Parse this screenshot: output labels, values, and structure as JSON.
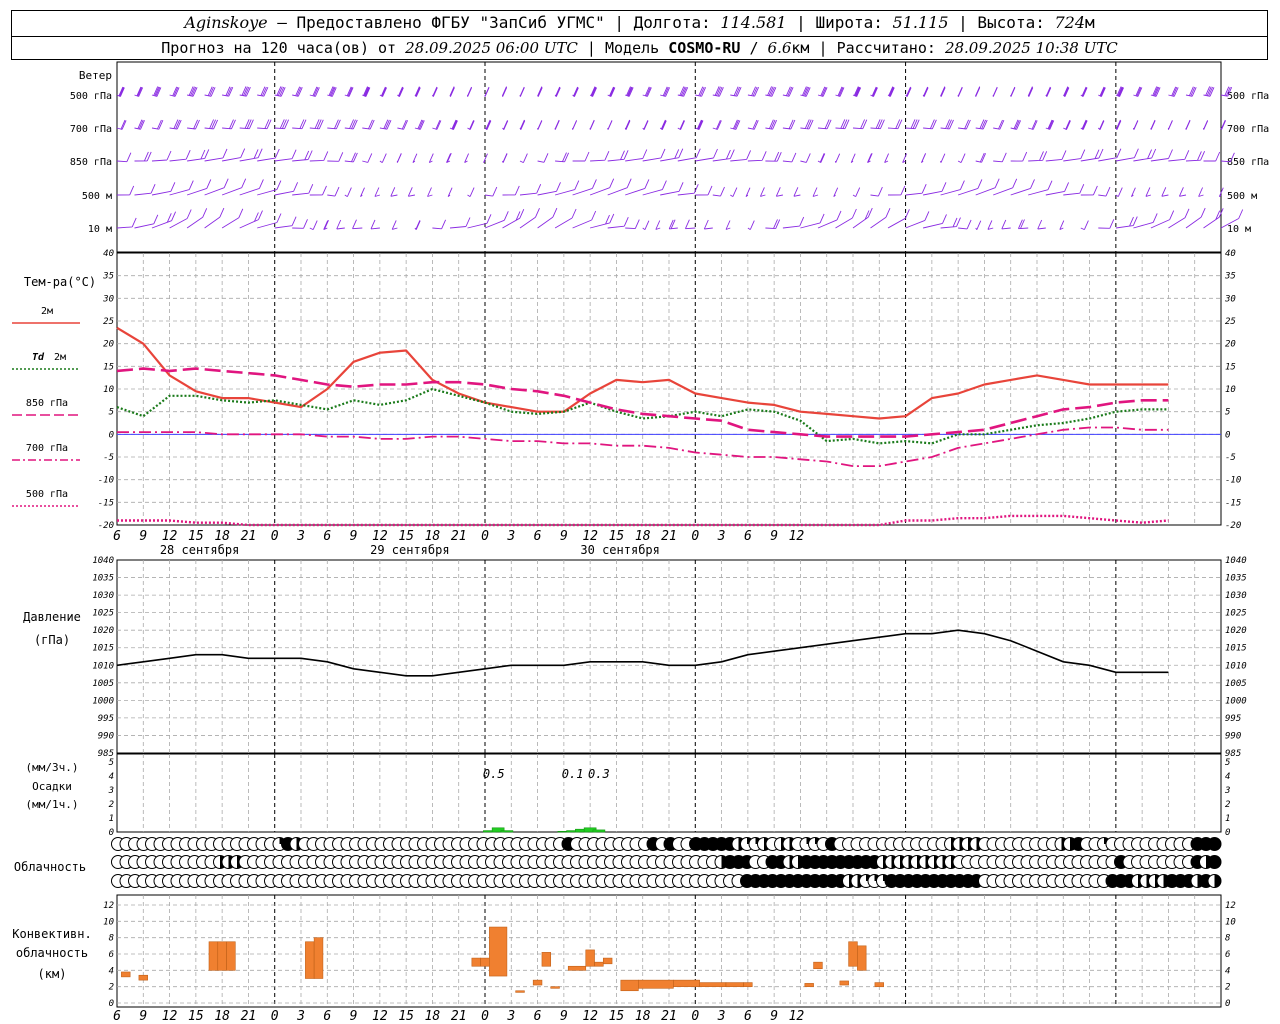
{
  "header": {
    "station": "Aginskoye",
    "provider": "Предоставлено ФГБУ \"ЗапСиб УГМС\"",
    "lon_label": "Долгота:",
    "lon": "114.581",
    "lat_label": "Широта:",
    "lat": "51.115",
    "alt_label": "Высота:",
    "alt_value": "724",
    "alt_unit": "м",
    "forecast_label": "Прогноз на 120 часа(ов) от",
    "forecast_start": "28.09.2025 06:00 UTC",
    "model_label": "Модель",
    "model_name": "COSMO-RU",
    "model_res_value": "6.6",
    "model_res_unit": "км",
    "computed_label": "Рассчитано:",
    "computed": "28.09.2025 10:38 UTC"
  },
  "time_axis": {
    "hour_labels": [
      "6",
      "9",
      "12",
      "15",
      "18",
      "21",
      "0",
      "3",
      "6",
      "9",
      "12",
      "15",
      "18",
      "21",
      "0",
      "3",
      "6",
      "9",
      "12",
      "15",
      "18",
      "21",
      "0",
      "3",
      "6",
      "9",
      "12"
    ],
    "day_labels": [
      "28 сентября",
      "29 сентября",
      "30 сентября"
    ]
  },
  "panels": {
    "wind": {
      "title": "Ветер",
      "levels": [
        "500 гПа",
        "700 гПа",
        "850 гПа",
        "500 м",
        "10  м"
      ]
    },
    "temperature": {
      "title": "Тем-ра(°C)",
      "legend": [
        {
          "label": "2м",
          "color": "#e8443a",
          "dash": "solid"
        },
        {
          "label_italic": "Td",
          "label": "2м",
          "color": "#1a7a1a",
          "dash": "dotted"
        },
        {
          "label": "850 гПа",
          "color": "#e0157f",
          "dash": "long"
        },
        {
          "label": "700 гПа",
          "color": "#e0157f",
          "dash": "dashdot"
        },
        {
          "label": "500 гПа",
          "color": "#e0157f",
          "dash": "dotted"
        }
      ]
    },
    "pressure": {
      "title": "Давление",
      "unit": "(гПа)"
    },
    "precip": {
      "unit1": "(мм/3ч.)",
      "title": "Осадки",
      "unit2": "(мм/1ч.)",
      "labels": [
        "0.5",
        "0.1",
        "0.3"
      ]
    },
    "cloud": {
      "title": "Облачность"
    },
    "convective": {
      "title1": "Конвективн.",
      "title2": "облачность",
      "unit": "(км)"
    }
  },
  "chart_data": [
    {
      "type": "line",
      "name": "temperature",
      "x_hours": [
        0,
        3,
        6,
        9,
        12,
        15,
        18,
        21,
        24,
        27,
        30,
        33,
        36,
        39,
        42,
        45,
        48,
        51,
        54,
        57,
        60,
        63,
        66,
        69,
        72,
        75,
        78,
        81,
        84,
        87,
        90,
        93,
        96,
        99,
        102,
        105,
        108,
        111,
        114,
        117,
        120
      ],
      "ylim": [
        -20,
        40
      ],
      "yticks": [
        -20,
        -15,
        -10,
        -5,
        0,
        5,
        10,
        15,
        20,
        25,
        30,
        35,
        40
      ],
      "series": [
        {
          "key": "t2m",
          "color": "#e8443a",
          "width": 2.2,
          "dash": "",
          "values": [
            23.5,
            20,
            13,
            9.5,
            8,
            8,
            7,
            6,
            10,
            16,
            18,
            18.5,
            12,
            9,
            7,
            6,
            5,
            5,
            9,
            12,
            11.5,
            12,
            9,
            8,
            7,
            6.5,
            5,
            4.5,
            4,
            3.5,
            4,
            8,
            9,
            11,
            12,
            13,
            12,
            11,
            11,
            11,
            11
          ]
        },
        {
          "key": "td2m",
          "color": "#1a7a1a",
          "width": 2.2,
          "dash": "2,2",
          "values": [
            6,
            4,
            8.5,
            8.5,
            7.5,
            7,
            7.5,
            6.5,
            5.5,
            7.5,
            6.5,
            7.5,
            10,
            8.5,
            7,
            5,
            4.5,
            5,
            7,
            5,
            3.5,
            4,
            5,
            4,
            5.5,
            5,
            3,
            -1.5,
            -1,
            -2,
            -1.5,
            -2,
            0,
            0,
            1,
            2,
            2.5,
            3.5,
            5,
            5.5,
            5.5
          ]
        },
        {
          "key": "t850",
          "color": "#e0157f",
          "width": 2.6,
          "dash": "16,6",
          "values": [
            14,
            14.5,
            14,
            14.5,
            14,
            13.5,
            13,
            12,
            11,
            10.5,
            11,
            11,
            11.5,
            11.5,
            11,
            10,
            9.5,
            8.5,
            7,
            5.5,
            4.5,
            4,
            3.5,
            3,
            1,
            0.5,
            0,
            -0.5,
            -0.5,
            -0.5,
            -0.5,
            0,
            0.5,
            1,
            2.5,
            4,
            5.5,
            6,
            7,
            7.5,
            7.5
          ]
        },
        {
          "key": "t700",
          "color": "#e0157f",
          "width": 1.8,
          "dash": "12,4,2,4",
          "values": [
            0.5,
            0.5,
            0.5,
            0.5,
            0,
            0,
            0,
            0,
            -0.5,
            -0.5,
            -1,
            -1,
            -0.5,
            -0.5,
            -1,
            -1.5,
            -1.5,
            -2,
            -2,
            -2.5,
            -2.5,
            -3,
            -4,
            -4.5,
            -5,
            -5,
            -5.5,
            -6,
            -7,
            -7,
            -6,
            -5,
            -3,
            -2,
            -1,
            0,
            1,
            1.5,
            1.5,
            1,
            1
          ]
        },
        {
          "key": "t500",
          "color": "#e0157f",
          "width": 2.4,
          "dash": "2,2",
          "values": [
            -19,
            -19,
            -19,
            -19.5,
            -19.5,
            -20,
            -20,
            -20,
            -20,
            -20,
            -20,
            -20,
            -20,
            -20,
            -20,
            -20,
            -20,
            -20,
            -20,
            -20,
            -20,
            -20,
            -20,
            -20,
            -20,
            -20,
            -20,
            -20,
            -20,
            -20,
            -19,
            -19,
            -18.5,
            -18.5,
            -18,
            -18,
            -18,
            -18.5,
            -19,
            -19.5,
            -19
          ]
        }
      ]
    },
    {
      "type": "line",
      "name": "pressure",
      "x_hours": [
        0,
        3,
        6,
        9,
        12,
        15,
        18,
        21,
        24,
        27,
        30,
        33,
        36,
        39,
        42,
        45,
        48,
        51,
        54,
        57,
        60,
        63,
        66,
        69,
        72,
        75,
        78,
        81,
        84,
        87,
        90,
        93,
        96,
        99,
        102,
        105,
        108,
        111,
        114,
        117,
        120
      ],
      "ylim": [
        985,
        1040
      ],
      "yticks": [
        985,
        990,
        995,
        1000,
        1005,
        1010,
        1015,
        1020,
        1025,
        1030,
        1035,
        1040
      ],
      "series": [
        {
          "key": "pmsl",
          "color": "#000000",
          "width": 1.6,
          "values": [
            1010,
            1011,
            1012,
            1013,
            1013,
            1012,
            1012,
            1012,
            1011,
            1009,
            1008,
            1007,
            1007,
            1008,
            1009,
            1010,
            1010,
            1010,
            1011,
            1011,
            1011,
            1010,
            1010,
            1011,
            1013,
            1014,
            1015,
            1016,
            1017,
            1018,
            1019,
            1019,
            1020,
            1019,
            1017,
            1014,
            1011,
            1010,
            1008,
            1008,
            1008
          ]
        }
      ]
    },
    {
      "type": "bar",
      "name": "precipitation",
      "ylim": [
        0,
        5
      ],
      "yticks": [
        0,
        1,
        2,
        3,
        4,
        5
      ],
      "bars": [
        {
          "hour": 0.5,
          "value": 0.1
        },
        {
          "hour": 1.5,
          "value": 0.3
        },
        {
          "hour": 2.5,
          "value": 0.1
        },
        {
          "hour": 9,
          "value": 0.05
        },
        {
          "hour": 10,
          "value": 0.1
        },
        {
          "hour": 11,
          "value": 0.2
        },
        {
          "hour": 12,
          "value": 0.3
        },
        {
          "hour": 13,
          "value": 0.15
        }
      ]
    },
    {
      "type": "bar",
      "name": "convective_cloud",
      "ylim": [
        0,
        13
      ],
      "yticks": [
        0,
        2,
        4,
        6,
        8,
        10,
        12
      ],
      "bars": [
        {
          "h0": 0.5,
          "h1": 1.5,
          "base": 3.2,
          "top": 3.8
        },
        {
          "h0": 2.5,
          "h1": 3.5,
          "base": 2.8,
          "top": 3.4
        },
        {
          "h0": 10.5,
          "h1": 11.5,
          "base": 4.0,
          "top": 7.5
        },
        {
          "h0": 11.5,
          "h1": 12.5,
          "base": 4.0,
          "top": 7.5
        },
        {
          "h0": 12.5,
          "h1": 13.5,
          "base": 4.0,
          "top": 7.5
        },
        {
          "h0": 21.5,
          "h1": 22.5,
          "base": 3.0,
          "top": 7.5
        },
        {
          "h0": 22.5,
          "h1": 23.5,
          "base": 3.0,
          "top": 8.0
        },
        {
          "h0": 40.5,
          "h1": 41.5,
          "base": 4.5,
          "top": 5.5
        },
        {
          "h0": 41.5,
          "h1": 42.5,
          "base": 4.5,
          "top": 5.5
        },
        {
          "h0": 42.5,
          "h1": 44.5,
          "base": 3.3,
          "top": 9.3
        },
        {
          "h0": 45.5,
          "h1": 46.5,
          "base": 1.3,
          "top": 1.5
        },
        {
          "h0": 47.5,
          "h1": 48.5,
          "base": 2.2,
          "top": 2.8
        },
        {
          "h0": 48.5,
          "h1": 49.5,
          "base": 4.5,
          "top": 6.2
        },
        {
          "h0": 49.5,
          "h1": 50.5,
          "base": 1.8,
          "top": 2.0
        },
        {
          "h0": 51.5,
          "h1": 53.5,
          "base": 4.0,
          "top": 4.5
        },
        {
          "h0": 53.5,
          "h1": 54.5,
          "base": 4.5,
          "top": 6.5
        },
        {
          "h0": 54.5,
          "h1": 55.5,
          "base": 4.5,
          "top": 5.0
        },
        {
          "h0": 55.5,
          "h1": 56.5,
          "base": 4.8,
          "top": 5.5
        },
        {
          "h0": 57.5,
          "h1": 59.5,
          "base": 1.5,
          "top": 2.8
        },
        {
          "h0": 59.5,
          "h1": 63.5,
          "base": 1.8,
          "top": 2.8
        },
        {
          "h0": 63.5,
          "h1": 66.5,
          "base": 2.0,
          "top": 2.8
        },
        {
          "h0": 66.5,
          "h1": 69.5,
          "base": 2.0,
          "top": 2.5
        },
        {
          "h0": 69.5,
          "h1": 71.5,
          "base": 2.0,
          "top": 2.5
        },
        {
          "h0": 71.5,
          "h1": 72.5,
          "base": 2.0,
          "top": 2.5
        },
        {
          "h0": 78.5,
          "h1": 79.5,
          "base": 2.0,
          "top": 2.4
        },
        {
          "h0": 79.5,
          "h1": 80.5,
          "base": 4.2,
          "top": 5.0
        },
        {
          "h0": 82.5,
          "h1": 83.5,
          "base": 2.2,
          "top": 2.7
        },
        {
          "h0": 83.5,
          "h1": 84.5,
          "base": 4.5,
          "top": 7.5
        },
        {
          "h0": 84.5,
          "h1": 85.5,
          "base": 4.0,
          "top": 7.0
        },
        {
          "h0": 86.5,
          "h1": 87.5,
          "base": 2.0,
          "top": 2.5
        }
      ]
    }
  ],
  "cloud_rows": [
    "0000000000000000000312000000000000000000000000000000010000000001010011111233202203301000000000000022220000000002210030000000000111",
    "0000000000002220000000000000000000000000000000000000000000000000000000021110011221111111112222222220000000000000000000100000000121",
    "0000000000000000000000000000000000000000000000000000000000000000000000000011111111111122333111111111110000000000000001112222111212"
  ]
}
